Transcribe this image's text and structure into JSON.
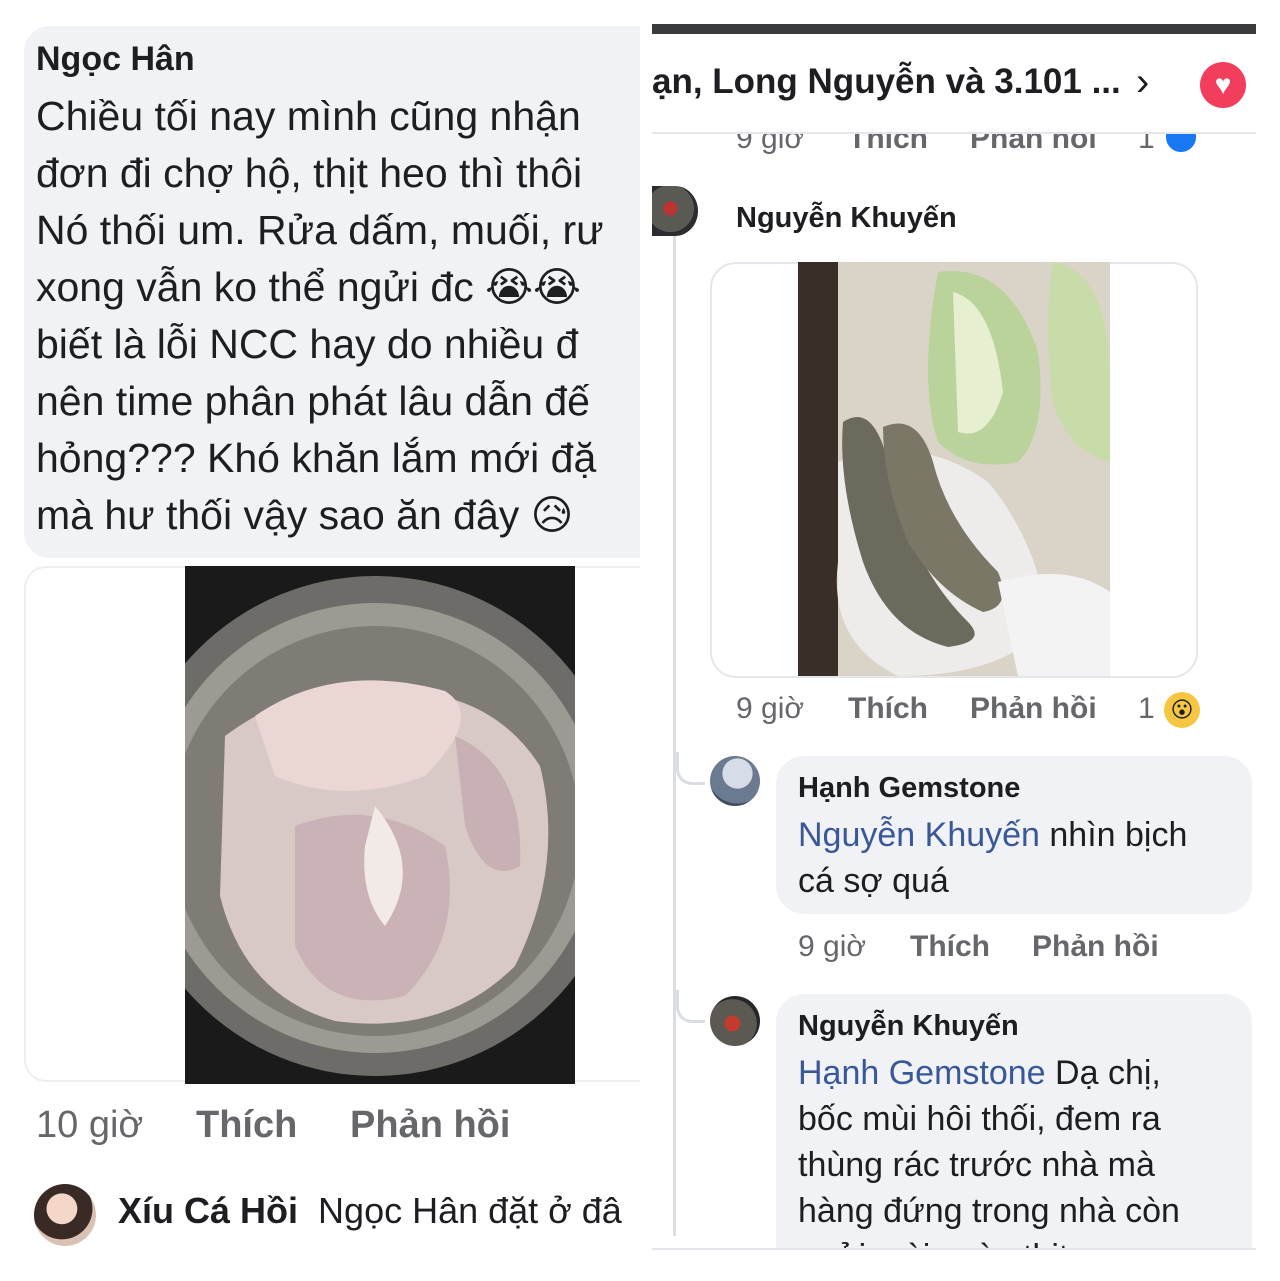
{
  "left": {
    "comment": {
      "author": "Ngọc Hân",
      "lines": [
        "Chiều tối nay mình cũng nhận",
        "đơn đi chợ hộ, thịt heo thì thôi",
        "Nó thối um. Rửa dấm, muối, rư",
        "xong vẫn ko thể ngửi đc 😭😭",
        "biết là lỗi NCC hay do nhiều đ",
        "nên time phân phát lâu dẫn đế",
        "hỏng??? Khó khăn lắm mới đặ",
        "mà hư thối vậy sao ăn đây 😥"
      ],
      "time": "10 giờ",
      "like": "Thích",
      "reply": "Phản hồi"
    },
    "reply_preview": {
      "author": "Xíu Cá Hồi",
      "text": "Ngọc Hân đặt ở đâ"
    }
  },
  "right": {
    "header": {
      "reactors": "ạn, Long Nguyễn và 3.101 ...",
      "chevron_icon": "›",
      "heart_icon": "♥"
    },
    "clipped_meta": {
      "time": "9 giờ",
      "like": "Thích",
      "reply": "Phản hồi",
      "count": "1"
    },
    "nk_comment": {
      "author": "Nguyễn Khuyến",
      "time": "9 giờ",
      "like": "Thích",
      "reply": "Phản hồi",
      "reaction_count": "1",
      "reaction_icon": "😮"
    },
    "hanh_comment": {
      "author": "Hạnh Gemstone",
      "mention": "Nguyễn Khuyến",
      "text_line1": " nhìn bịch",
      "text_line2": "cá sợ quá",
      "time": "9 giờ",
      "like": "Thích",
      "reply": "Phản hồi"
    },
    "nk_reply": {
      "author": "Nguyễn Khuyến",
      "mention": "Hạnh Gemstone",
      "line1_rest": " Dạ chị,",
      "line2": "bốc mùi hôi thối, đem ra",
      "line3": "thùng rác trước nhà mà",
      "line4": "hàng đứng trong nhà còn",
      "line5": "ngửi mùi , còn thịt"
    }
  },
  "colors": {
    "bubble": "#f0f2f5",
    "meta_text": "#65676b",
    "mention": "#385898",
    "heart": "#f23e5c"
  }
}
